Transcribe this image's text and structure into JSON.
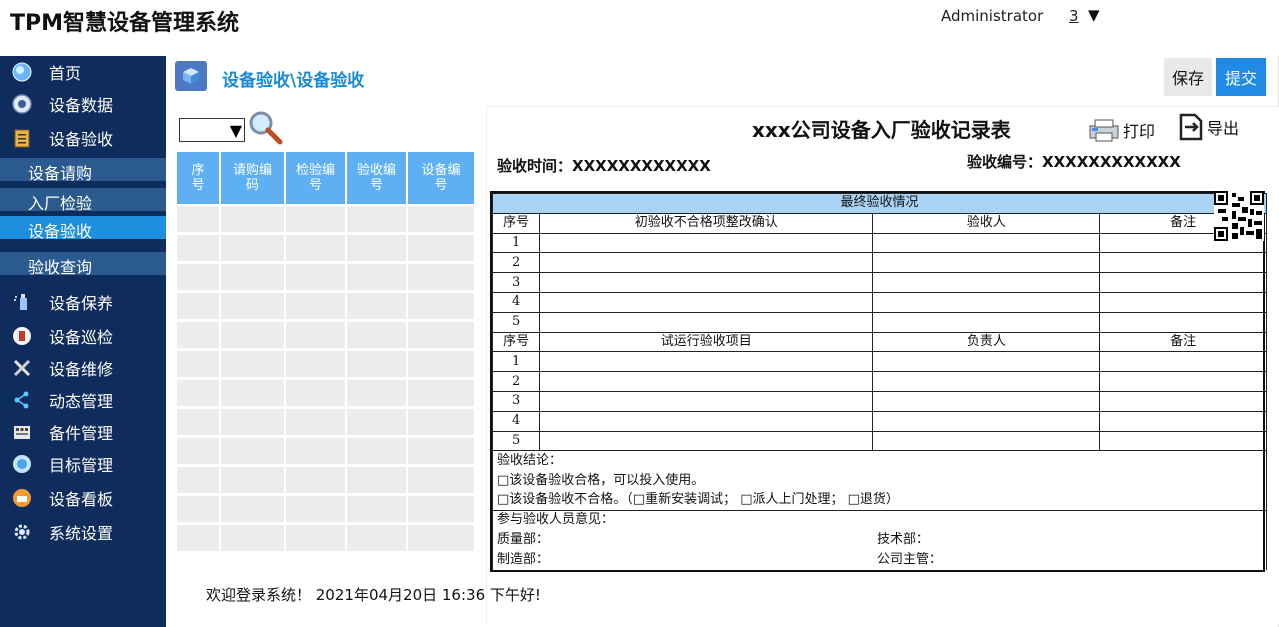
{
  "header": {
    "title": "TPM智慧设备管理系统",
    "user": "Administrator",
    "count": "3",
    "caret": "▼"
  },
  "sidebar": {
    "items": [
      {
        "label": "首页",
        "icon": "globe-icon"
      },
      {
        "label": "设备数据",
        "icon": "database-icon"
      },
      {
        "label": "设备验收",
        "icon": "clipboard-icon"
      },
      {
        "label": "设备保养",
        "icon": "spray-icon"
      },
      {
        "label": "设备巡检",
        "icon": "inspection-icon"
      },
      {
        "label": "设备维修",
        "icon": "tools-icon"
      },
      {
        "label": "动态管理",
        "icon": "share-icon"
      },
      {
        "label": "备件管理",
        "icon": "parts-icon"
      },
      {
        "label": "目标管理",
        "icon": "target-icon"
      },
      {
        "label": "设备看板",
        "icon": "dashboard-icon"
      },
      {
        "label": "系统设置",
        "icon": "gear-icon"
      }
    ],
    "subitems": [
      {
        "label": "设备请购"
      },
      {
        "label": "入厂检验"
      },
      {
        "label": "设备验收"
      },
      {
        "label": "验收查询"
      }
    ]
  },
  "content": {
    "breadcrumb": "设备验收\\设备验收",
    "save_label": "保存",
    "submit_label": "提交"
  },
  "list": {
    "select_value": "",
    "select_arrow": "▼",
    "columns": [
      "序\n号",
      "请购编\n码",
      "检验编\n号",
      "验收编\n号",
      "设备编\n号"
    ]
  },
  "form": {
    "title": "xxx公司设备入厂验收记录表",
    "print_label": "打印",
    "export_label": "导出",
    "accept_time": "验收时间：XXXXXXXXXXXX",
    "accept_no": "验收编号：XXXXXXXXXXXX",
    "final_band": "最终验收情况",
    "section1": {
      "c1": "序号",
      "c2": "初验收不合格项整改确认",
      "c3": "验收人",
      "c4": "备注"
    },
    "section2": {
      "c1": "序号",
      "c2": "试运行验收项目",
      "c3": "负责人",
      "c4": "备注"
    },
    "rows": [
      "1",
      "2",
      "3",
      "4",
      "5"
    ],
    "conclusion_title": "验收结论：",
    "conclusion_ok": "□该设备验收合格，可以投入使用。",
    "conclusion_ng": "□该设备验收不合格。（□重新安装调试；  □派人上门处理；  □退货）",
    "opinion_title": "参与验收人员意见：",
    "quality_dept": "质量部：",
    "tech_dept": "技术部：",
    "manu_dept": "制造部：",
    "manager": "公司主管："
  },
  "footer": {
    "text": "欢迎登录系统！ 2021年04月20日 16:36 下午好!"
  }
}
